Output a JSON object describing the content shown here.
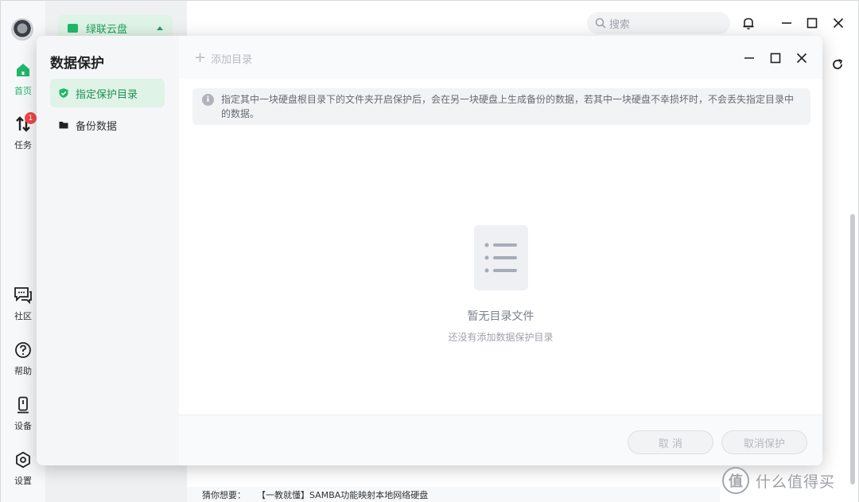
{
  "app": {
    "rail": {
      "home_label": "首页",
      "tasks_label": "任务",
      "tasks_badge": "1",
      "community_label": "社区",
      "help_label": "帮助",
      "devices_label": "设备",
      "settings_label": "设置"
    },
    "drive_label": "绿联云盘",
    "search": {
      "placeholder": "搜索"
    },
    "bottom": {
      "prefix": "猜你想要：",
      "link": "【一教就懂】SAMBA功能映射本地网络硬盘"
    },
    "watermark": {
      "logo_char": "值",
      "text": "什么值得买"
    }
  },
  "dialog": {
    "title": "数据保护",
    "nav": [
      {
        "label": "指定保护目录",
        "icon": "shield-icon",
        "active": true
      },
      {
        "label": "备份数据",
        "icon": "folder-icon",
        "active": false
      }
    ],
    "toolbar": {
      "add_label": "添加目录"
    },
    "info_text": "指定其中一块硬盘根目录下的文件夹开启保护后，会在另一块硬盘上生成备份的数据，若其中一块硬盘不幸损坏时，不会丢失指定目录中的数据。",
    "empty": {
      "title": "暂无目录文件",
      "subtitle": "还没有添加数据保护目录"
    },
    "footer": {
      "cancel_label": "取 消",
      "cancel_protect_label": "取消保护"
    }
  },
  "colors": {
    "accent": "#1fb86a",
    "accent_bg": "#dff3e6",
    "badge": "#f04848"
  }
}
